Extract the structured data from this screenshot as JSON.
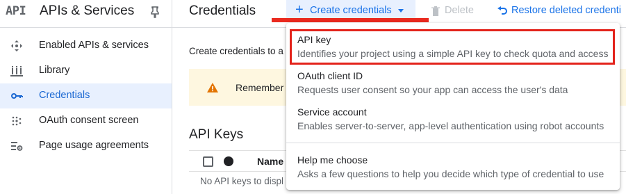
{
  "sidebar": {
    "logo_text": "API",
    "title": "APIs & Services",
    "items": [
      {
        "label": "Enabled APIs & services",
        "icon": "diamond-arrows-icon"
      },
      {
        "label": "Library",
        "icon": "library-icon"
      },
      {
        "label": "Credentials",
        "icon": "key-icon",
        "active": true
      },
      {
        "label": "OAuth consent screen",
        "icon": "dots-grid-icon"
      },
      {
        "label": "Page usage agreements",
        "icon": "settings-list-icon"
      }
    ]
  },
  "header": {
    "title": "Credentials",
    "create_label": "Create credentials",
    "delete_label": "Delete",
    "restore_label": "Restore deleted credenti"
  },
  "content": {
    "intro": "Create credentials to a",
    "warning_text": "Remember t",
    "warning_close": "x",
    "section_title": "API Keys",
    "table_columns": [
      "Name",
      "ic"
    ],
    "empty_text": "No API keys to displ"
  },
  "dropdown": {
    "items": [
      {
        "title": "API key",
        "description": "Identifies your project using a simple API key to check quota and access"
      },
      {
        "title": "OAuth client ID",
        "description": "Requests user consent so your app can access the user's data"
      },
      {
        "title": "Service account",
        "description": "Enables server-to-server, app-level authentication using robot accounts"
      },
      {
        "title": "Help me choose",
        "description": "Asks a few questions to help you decide which type of credential to use"
      }
    ]
  },
  "colors": {
    "accent": "#1a73e8",
    "active_bg": "#e8f0fe",
    "warning_bg": "#fef7e0",
    "warning_icon": "#e37400",
    "highlight": "#e3231b"
  }
}
